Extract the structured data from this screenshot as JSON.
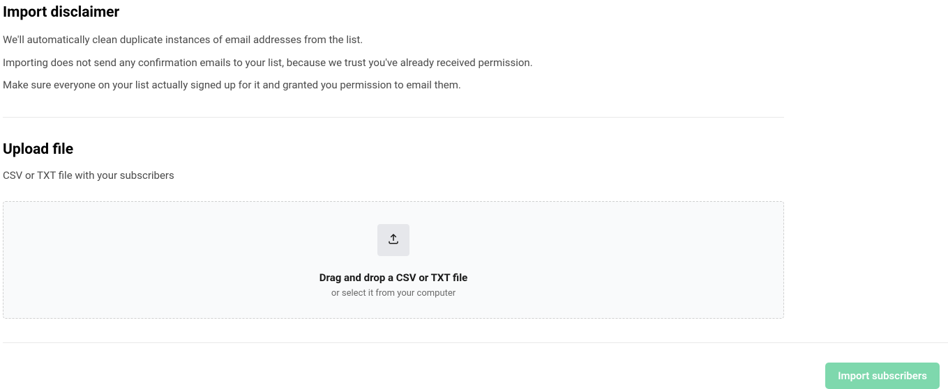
{
  "disclaimer": {
    "title": "Import disclaimer",
    "lines": [
      "We'll automatically clean duplicate instances of email addresses from the list.",
      "Importing does not send any confirmation emails to your list, because we trust you've already received permission.",
      "Make sure everyone on your list actually signed up for it and granted you permission to email them."
    ]
  },
  "upload": {
    "title": "Upload file",
    "subtitle": "CSV or TXT file with your subscribers",
    "drop_title": "Drag and drop a CSV or TXT file",
    "drop_subtitle": "or select it from your computer"
  },
  "actions": {
    "import_label": "Import subscribers"
  }
}
